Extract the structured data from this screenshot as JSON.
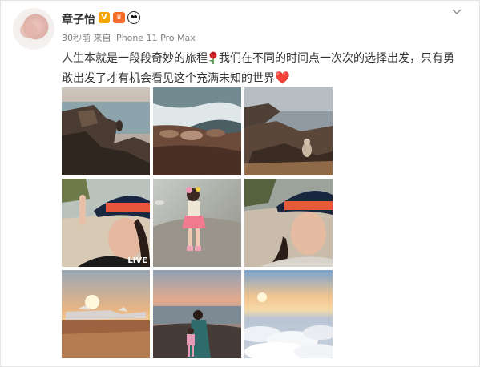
{
  "post": {
    "author_name": "章子怡",
    "badges": [
      "v-badge-icon",
      "member-badge-icon",
      "panda-icon"
    ],
    "time": "30秒前",
    "source_prefix": "来自",
    "source_device": "iPhone 11 Pro Max",
    "text_part1": "人生本就是一段段奇妙的旅程",
    "text_part2": "我们在不同的时间点一次次的选择出发，只有勇敢出发了才有机会看见这个充满未知的世界",
    "emoji_rose": "rose-icon",
    "emoji_heart": "❤️",
    "photos": [
      {
        "name": "photo-sea-lion-rocks",
        "scene": "coast-rocks"
      },
      {
        "name": "photo-sea-lions-beach",
        "scene": "sea-lions"
      },
      {
        "name": "photo-squirrel-rock",
        "scene": "squirrel"
      },
      {
        "name": "photo-selfie-hat-pointing",
        "scene": "selfie1",
        "live_label": "LIVE"
      },
      {
        "name": "photo-girl-on-beach",
        "scene": "girl"
      },
      {
        "name": "photo-selfie-hat-kiss",
        "scene": "selfie2"
      },
      {
        "name": "photo-sunset-planes",
        "scene": "planes"
      },
      {
        "name": "photo-mother-daughter-sunset",
        "scene": "mother"
      },
      {
        "name": "photo-sea-of-clouds",
        "scene": "clouds"
      }
    ]
  }
}
